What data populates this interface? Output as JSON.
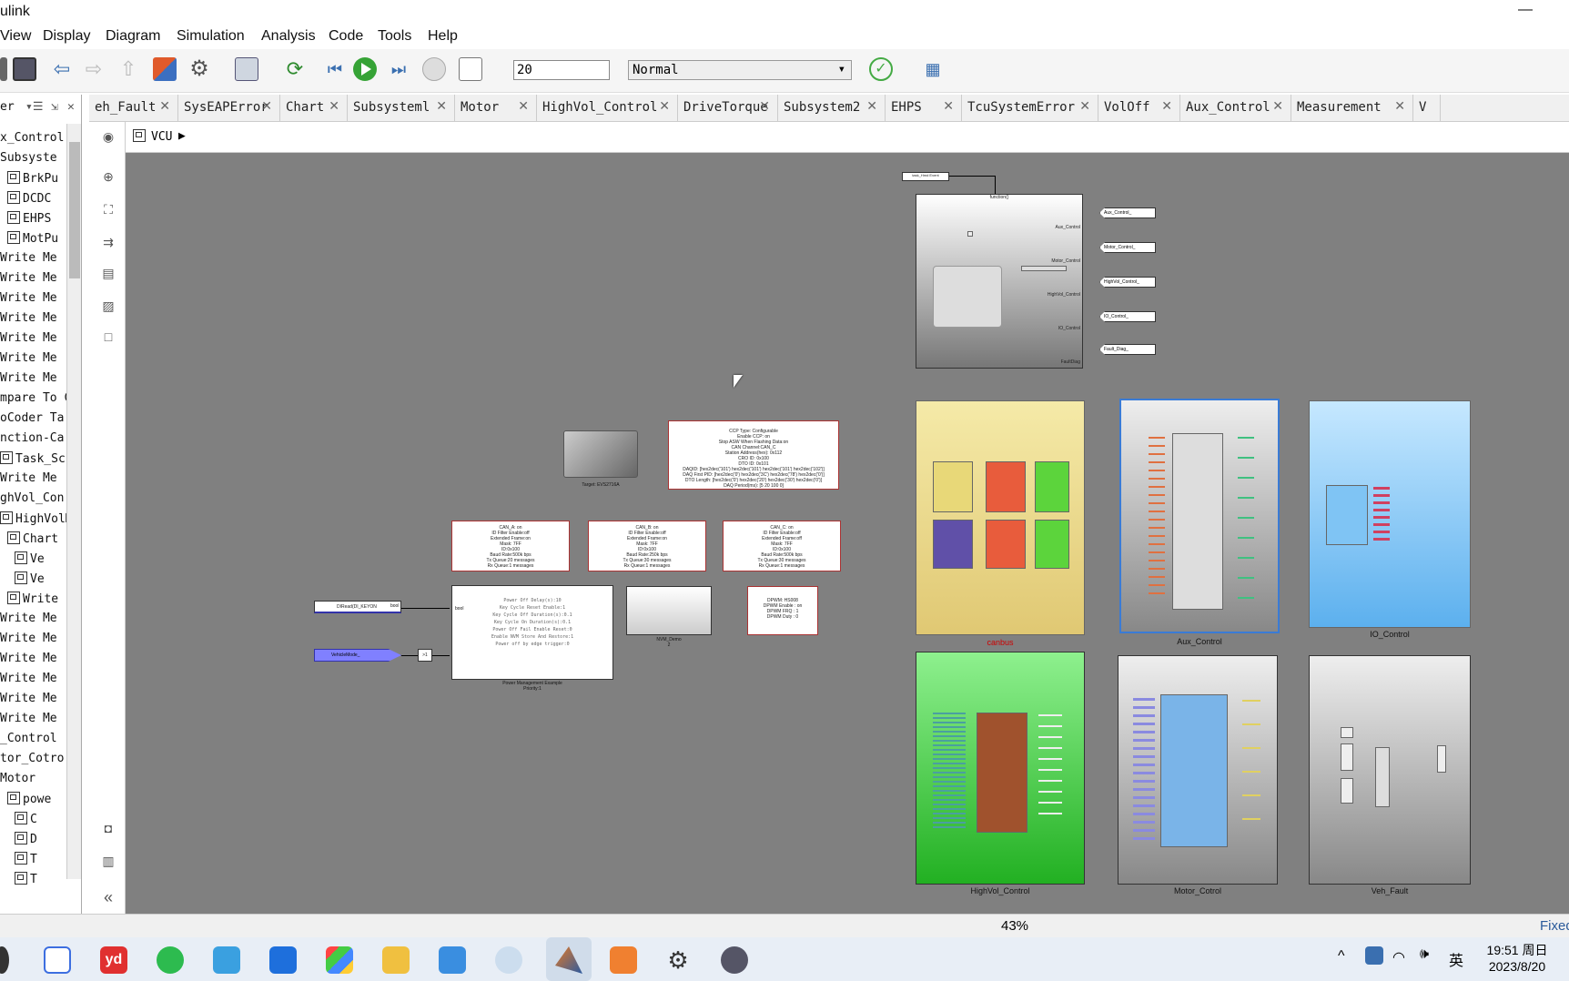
{
  "window": {
    "title": "ulink",
    "minimize": "—"
  },
  "menu": [
    "View",
    "Display",
    "Diagram",
    "Simulation",
    "Analysis",
    "Code",
    "Tools",
    "Help"
  ],
  "toolbar": {
    "stop_time": "20",
    "mode": "Normal"
  },
  "tabs": [
    "eh_Fault",
    "SysEAPError",
    "Chart",
    "Subsysteml",
    "Motor",
    "HighVol_Control",
    "DriveTorque",
    "Subsystem2",
    "EHPS",
    "TcuSystemError",
    "VolOff",
    "Aux_Control",
    "Measurement",
    "V"
  ],
  "left_panel": {
    "header": "er",
    "items": [
      "x_Control",
      "Subsyste",
      "BrkPu",
      "DCDC",
      "EHPS",
      "MotPu",
      "Write Me",
      "Write Me",
      "Write Me",
      "Write Me",
      "Write Me",
      "Write Me",
      "Write Me",
      "mpare To C",
      "oCoder Ta:",
      "nction-Ca",
      "Task_Sch",
      "Write Me",
      "ghVol_Con",
      "HighVolM",
      "Chart",
      "Ve",
      "Ve",
      "Write",
      "Write Me",
      "Write Me",
      "Write Me",
      "Write Me",
      "Write Me",
      "Write Me",
      "_Control",
      "tor_Cotro",
      "Motor",
      "powe",
      "C",
      "D",
      "T",
      "T"
    ]
  },
  "address": {
    "path": "VCU"
  },
  "blocks": {
    "function_caller": "function()",
    "target_caption": "Target: EVS2716A",
    "ccp_text": [
      "CCP Type: Configurable",
      "Enable CCP: on",
      "Stop ASW When Flashing Data:on",
      "CAN Channel:CAN_C",
      "Station Address(hex): 0x112",
      "CRO ID: 0x100",
      "DTO ID: 0x101",
      "DAQID: [hex2dec('101') hex2dec('101') hex2dec('101') hex2dec('102')]",
      "DAQ First PID: [hex2dec('0') hex2dec('3C') hex2dec('78') hex2dec('0')]",
      "DTO Length: [hex2dec('0') hex2dec('20') hex2dec('30') hex2dec('0')]",
      "DAQ Period(ms): [5 20 100 0]"
    ],
    "can_a": [
      "CAN_A: on",
      "ID Filter Enable:off",
      "Extended Frame:on",
      "Mask: 7FF",
      "ID:0x100",
      "Baud Rate:500k bps",
      "Tx Queue:20 messages",
      "Rx Queue:1 messages"
    ],
    "can_b": [
      "CAN_B: on",
      "ID Filter Enable:off",
      "Extended Frame:on",
      "Mask: 7FF",
      "ID:0x100",
      "Baud Rate:250k bps",
      "Tx Queue:30 messages",
      "Rx Queue:1 messages"
    ],
    "can_c": [
      "CAN_C: on",
      "ID Filter Enable:off",
      "Extended Frame:off",
      "Mask: 7FF",
      "ID:0x100",
      "Baud Rate:500k bps",
      "Tx Queue:30 messages",
      "Rx Queue:1 messages"
    ],
    "power_text": [
      "Power Off Delay(s):10",
      "Key Cycle Reset Enable:1",
      "Key Cycle Off Duration(s):0.1",
      "Key Cycle On Duration(s):0.1",
      "Power Off Fail Enable Reset:0",
      "Enable NVM Store And Restore:1",
      "Power off by edge trigger:0"
    ],
    "power_caption": "Power Management Example",
    "power_sub": "Priority:1",
    "nvm_caption": "NVM_Demo",
    "nvm_sub": "2",
    "dpwm_text": [
      "DPWM: HS008",
      "DPWM Enable : on",
      "DPWM FRQ : 1",
      "DPWM Duty : 0"
    ],
    "di_read": "DIRead(DI_KEYON",
    "bool1": "bool",
    "bool2": "bool",
    "vehicle_mode": "VehicleMode_",
    "out_ports": [
      "Aux_Control_",
      "Motor_Control_",
      "HighVol_Control_",
      "IO_Control_",
      "Fault_Diag_"
    ],
    "in_ports": [
      "Aux_Control",
      "Motor_Control",
      "HighVol_Control",
      "IO_Control",
      "FaultDiag"
    ],
    "task_block": "task_Hmd Event"
  },
  "subsystems": [
    "canbus",
    "Aux_Control",
    "IO_Control",
    "HighVol_Control",
    "Motor_Cotrol",
    "Veh_Fault"
  ],
  "status": {
    "zoom": "43%",
    "solver": "Fixed"
  },
  "clock": {
    "time": "19:51 周日",
    "date": "2023/8/20",
    "ime": "英"
  }
}
